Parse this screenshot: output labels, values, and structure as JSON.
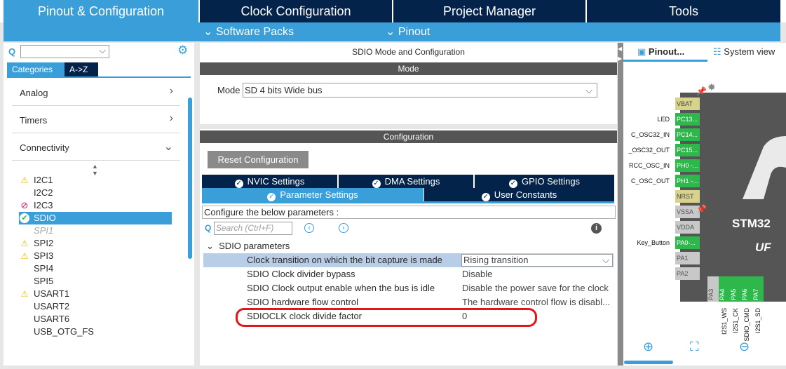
{
  "top_tabs": [
    "Pinout & Configuration",
    "Clock Configuration",
    "Project Manager",
    "Tools"
  ],
  "sub_tabs": [
    "Software Packs",
    "Pinout"
  ],
  "left": {
    "category_tabs": [
      "Categories",
      "A->Z"
    ],
    "categories": [
      "Analog",
      "Timers",
      "Connectivity"
    ],
    "items": [
      {
        "label": "I2C1",
        "status": "warn"
      },
      {
        "label": "I2C2",
        "status": "none"
      },
      {
        "label": "I2C3",
        "status": "error"
      },
      {
        "label": "SDIO",
        "status": "ok"
      },
      {
        "label": "SPI1",
        "status": "disabled"
      },
      {
        "label": "SPI2",
        "status": "warn"
      },
      {
        "label": "SPI3",
        "status": "warn"
      },
      {
        "label": "SPI4",
        "status": "none"
      },
      {
        "label": "SPI5",
        "status": "none"
      },
      {
        "label": "USART1",
        "status": "warn"
      },
      {
        "label": "USART2",
        "status": "none"
      },
      {
        "label": "USART6",
        "status": "none"
      },
      {
        "label": "USB_OTG_FS",
        "status": "none"
      }
    ]
  },
  "center": {
    "title": "SDIO Mode and Configuration",
    "mode_header": "Mode",
    "mode_label": "Mode",
    "mode_value": "SD 4 bits Wide bus",
    "config_header": "Configuration",
    "reset_button": "Reset Configuration",
    "tabs": [
      "NVIC Settings",
      "DMA Settings",
      "GPIO Settings",
      "Parameter Settings",
      "User Constants"
    ],
    "configure_text": "Configure the below parameters :",
    "search_placeholder": "Search (Ctrl+F)",
    "group_label": "SDIO parameters",
    "params": [
      {
        "key": "Clock transition on which the bit capture is made",
        "value": "Rising transition"
      },
      {
        "key": "SDIO Clock divider bypass",
        "value": "Disable"
      },
      {
        "key": "SDIO Clock output enable when the bus is idle",
        "value": "Disable the power save for the clock"
      },
      {
        "key": "SDIO hardware flow control",
        "value": "The hardware control flow is disabl..."
      },
      {
        "key": "SDIOCLK clock divide factor",
        "value": "0"
      }
    ],
    "highlight_color": "#e0161c"
  },
  "right": {
    "tabs": [
      "Pinout...",
      "System view"
    ],
    "left_pins": [
      {
        "pin": "VBAT",
        "label": "",
        "color": "y"
      },
      {
        "pin": "PC13...",
        "label": "LED",
        "color": "g"
      },
      {
        "pin": "PC14...",
        "label": "C_OSC32_IN",
        "color": "g"
      },
      {
        "pin": "PC15...",
        "label": "_OSC32_OUT",
        "color": "g"
      },
      {
        "pin": "PH0 -...",
        "label": "RCC_OSC_IN",
        "color": "g"
      },
      {
        "pin": "PH1 -...",
        "label": "C_OSC_OUT",
        "color": "g"
      },
      {
        "pin": "NRST",
        "label": "",
        "color": "y"
      },
      {
        "pin": "VSSA",
        "label": "",
        "color": "gr"
      },
      {
        "pin": "VDDA",
        "label": "",
        "color": "gr"
      },
      {
        "pin": "PA0-...",
        "label": "Key_Button",
        "color": "g"
      },
      {
        "pin": "PA1",
        "label": "",
        "color": "gr"
      },
      {
        "pin": "PA2",
        "label": "",
        "color": "gr"
      }
    ],
    "bottom_pins": [
      {
        "pin": "PA3",
        "label": "",
        "color": "gr"
      },
      {
        "pin": "PA4",
        "label": "I2S1_WS",
        "color": "g"
      },
      {
        "pin": "PA5",
        "label": "I2S1_CK",
        "color": "g"
      },
      {
        "pin": "PA6",
        "label": "SDIO_CMD",
        "color": "g"
      },
      {
        "pin": "PA7",
        "label": "I2S1_SD",
        "color": "g"
      }
    ],
    "chip_name": "STM32",
    "chip_sub": "UF"
  }
}
